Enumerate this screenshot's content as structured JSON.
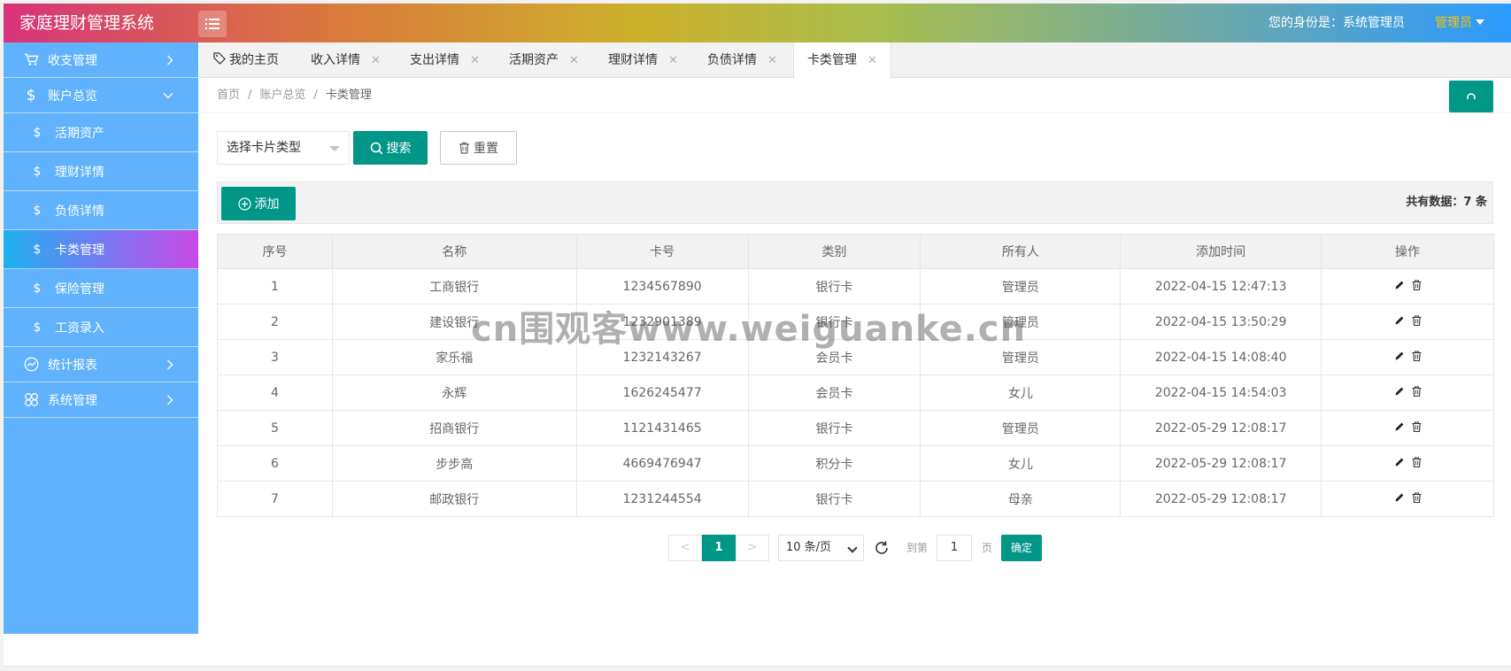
{
  "header": {
    "app_title": "家庭理财管理系统",
    "identity_text": "您的身份是：系统管理员",
    "user_role": "管理员"
  },
  "sidebar": {
    "items": [
      {
        "label": "收支管理",
        "icon": "cart-icon",
        "kind": "top",
        "chevron": "right"
      },
      {
        "label": "账户总览",
        "icon": "dollar-icon",
        "kind": "top",
        "chevron": "down"
      },
      {
        "label": "活期资产",
        "icon": "dollar-icon",
        "kind": "sub"
      },
      {
        "label": "理财详情",
        "icon": "dollar-icon",
        "kind": "sub"
      },
      {
        "label": "负债详情",
        "icon": "dollar-icon",
        "kind": "sub"
      },
      {
        "label": "卡类管理",
        "icon": "dollar-icon",
        "kind": "sub",
        "active": true
      },
      {
        "label": "保险管理",
        "icon": "dollar-icon",
        "kind": "sub"
      },
      {
        "label": "工资录入",
        "icon": "dollar-icon",
        "kind": "sub"
      },
      {
        "label": "统计报表",
        "icon": "chart-line-icon",
        "kind": "top",
        "chevron": "right"
      },
      {
        "label": "系统管理",
        "icon": "flower-icon",
        "kind": "top",
        "chevron": "right"
      }
    ],
    "glyph_dollar": "$"
  },
  "tabs": [
    {
      "label": "我的主页",
      "closable": false
    },
    {
      "label": "收入详情",
      "closable": true
    },
    {
      "label": "支出详情",
      "closable": true
    },
    {
      "label": "活期资产",
      "closable": true
    },
    {
      "label": "理财详情",
      "closable": true
    },
    {
      "label": "负债详情",
      "closable": true
    },
    {
      "label": "卡类管理",
      "closable": true,
      "active": true
    }
  ],
  "tab_close_glyph": "✕",
  "breadcrumb": {
    "items": [
      "首页",
      "账户总览",
      "卡类管理"
    ],
    "separator": "/"
  },
  "search": {
    "select_placeholder": "选择卡片类型",
    "search_label": "搜索",
    "reset_label": "重置"
  },
  "toolbar": {
    "add_label": "添加",
    "total_text": "共有数据：7 条"
  },
  "table": {
    "columns": [
      "序号",
      "名称",
      "卡号",
      "类别",
      "所有人",
      "添加时间",
      "操作"
    ],
    "rows": [
      [
        "1",
        "工商银行",
        "1234567890",
        "银行卡",
        "管理员",
        "2022-04-15 12:47:13"
      ],
      [
        "2",
        "建设银行",
        "1232901389",
        "银行卡",
        "管理员",
        "2022-04-15 13:50:29"
      ],
      [
        "3",
        "家乐福",
        "1232143267",
        "会员卡",
        "管理员",
        "2022-04-15 14:08:40"
      ],
      [
        "4",
        "永辉",
        "1626245477",
        "会员卡",
        "女儿",
        "2022-04-15 14:54:03"
      ],
      [
        "5",
        "招商银行",
        "1121431465",
        "银行卡",
        "管理员",
        "2022-05-29 12:08:17"
      ],
      [
        "6",
        "步步高",
        "4669476947",
        "积分卡",
        "女儿",
        "2022-05-29 12:08:17"
      ],
      [
        "7",
        "邮政银行",
        "1231244554",
        "银行卡",
        "母亲",
        "2022-05-29 12:08:17"
      ]
    ]
  },
  "pagination": {
    "prev": "<",
    "current_page": "1",
    "next": ">",
    "page_size": "10 条/页",
    "goto_label": "到第",
    "goto_value": "1",
    "page_unit": "页",
    "confirm_label": "确定"
  },
  "watermark": "cn围观客www.weiguanke.cn",
  "colors": {
    "primary": "#009688",
    "sidebar_bg": "#5fb2fb",
    "role_accent": "#ffc107"
  }
}
